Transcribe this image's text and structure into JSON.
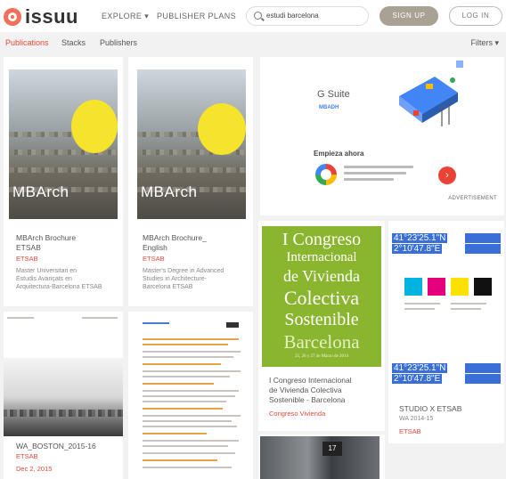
{
  "header": {
    "logo": "issuu",
    "nav": {
      "explore": "EXPLORE ▾",
      "plans": "PUBLISHER PLANS"
    },
    "search": {
      "value": "estudi barcelona"
    },
    "signup": "SIGN UP",
    "login": "LOG IN"
  },
  "tabs": {
    "publications": "Publications",
    "stacks": "Stacks",
    "publishers": "Publishers",
    "filters": "Filters ▾"
  },
  "cards": [
    {
      "cover_label": "MBArch",
      "title_line1": "MBArch Brochure",
      "title_line2": "ETSAB",
      "author": "ETSAB",
      "desc_line1": "Master Universitari en",
      "desc_line2": "Estudis Avançats en",
      "desc_line3": "Arquitectura-Barcelona ETSAB"
    },
    {
      "cover_label": "MBArch",
      "title_line1": "MBArch Brochure_",
      "title_line2": "English",
      "author": "ETSAB",
      "desc_line1": "Master's Degree in Advanced",
      "desc_line2": "Studies in Architecture-",
      "desc_line3": "Barcelona ETSAB"
    },
    {
      "title": "WA_BOSTON_2015-16",
      "author": "ETSAB",
      "date": "Dec 2, 2015"
    },
    {
      "title_line1": "I Congreso Internacional",
      "title_line2": "de Vivienda Colectiva",
      "title_line3": "Sostenible - Barcelona",
      "author": "Congreso Vivienda"
    },
    {
      "label1": "41°23'25.1\"N",
      "label2": "2°10'47.8\"E",
      "title": "STUDIO X ETSAB",
      "desc": "WA 2014-15",
      "author": "ETSAB"
    }
  ],
  "congreso_cover": {
    "line1": "I Congreso",
    "line2": "Internacional",
    "line3": "de Vivienda",
    "line4": "Colectiva",
    "line5": "Sostenible",
    "line6": "Barcelona",
    "line7": "25, 26 y 27 de Marzo de 2014"
  },
  "ad": {
    "brand": "G Suite",
    "mark": "MBADH",
    "headline": "Empieza ahora",
    "cta_icon": "arrow-right-icon",
    "footer": "ADVERTISEMENT"
  },
  "colors": {
    "accent": "#e24a3b",
    "signup_bg": "#aaa195",
    "congreso_green": "#8ab52e",
    "coords_blue": "#3a6fd8",
    "disc_yellow": "#f6e32b"
  }
}
